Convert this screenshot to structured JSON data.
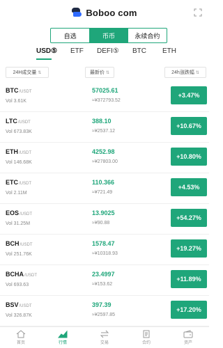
{
  "brand": {
    "name": "Boboo com"
  },
  "segments": [
    {
      "label": "自选",
      "active": false
    },
    {
      "label": "币币",
      "active": true
    },
    {
      "label": "永续合约",
      "active": false
    }
  ],
  "quote_tabs": [
    {
      "label": "USD⑤",
      "active": true
    },
    {
      "label": "ETF",
      "active": false
    },
    {
      "label": "DEFI⑤",
      "active": false
    },
    {
      "label": "BTC",
      "active": false
    },
    {
      "label": "ETH",
      "active": false
    }
  ],
  "filters": {
    "volume": "24H成交量",
    "price": "最新价",
    "change": "24h涨跌幅"
  },
  "markets": [
    {
      "symbol": "BTC",
      "unit": "/USDT",
      "vol": "Vol 3.61K",
      "price": "57025.61",
      "cny": "≈¥372793.52",
      "change": "+3.47%"
    },
    {
      "symbol": "LTC",
      "unit": "/USDT",
      "vol": "Vol 673.83K",
      "price": "388.10",
      "cny": "≈¥2537.12",
      "change": "+10.67%"
    },
    {
      "symbol": "ETH",
      "unit": "/USDT",
      "vol": "Vol 146.68K",
      "price": "4252.98",
      "cny": "≈¥27803.00",
      "change": "+10.80%"
    },
    {
      "symbol": "ETC",
      "unit": "/USDT",
      "vol": "Vol 2.11M",
      "price": "110.366",
      "cny": "≈¥721.49",
      "change": "+4.53%"
    },
    {
      "symbol": "EOS",
      "unit": "/USDT",
      "vol": "Vol 31.25M",
      "price": "13.9025",
      "cny": "≈¥90.88",
      "change": "+54.27%"
    },
    {
      "symbol": "BCH",
      "unit": "/USDT",
      "vol": "Vol 251.76K",
      "price": "1578.47",
      "cny": "≈¥10318.93",
      "change": "+19.27%"
    },
    {
      "symbol": "BCHA",
      "unit": "/USDT",
      "vol": "Vol 693.63",
      "price": "23.4997",
      "cny": "≈¥153.62",
      "change": "+11.89%"
    },
    {
      "symbol": "BSV",
      "unit": "/USDT",
      "vol": "Vol 326.87K",
      "price": "397.39",
      "cny": "≈¥2597.85",
      "change": "+17.20%"
    }
  ],
  "bottom_nav": [
    {
      "label": "首页",
      "icon": "home-icon",
      "active": false
    },
    {
      "label": "行情",
      "icon": "chart-icon",
      "active": true
    },
    {
      "label": "交易",
      "icon": "trade-icon",
      "active": false
    },
    {
      "label": "合约",
      "icon": "contract-icon",
      "active": false
    },
    {
      "label": "资产",
      "icon": "wallet-icon",
      "active": false
    }
  ],
  "colors": {
    "accent": "#1fa67a",
    "up": "#1fa67a"
  }
}
